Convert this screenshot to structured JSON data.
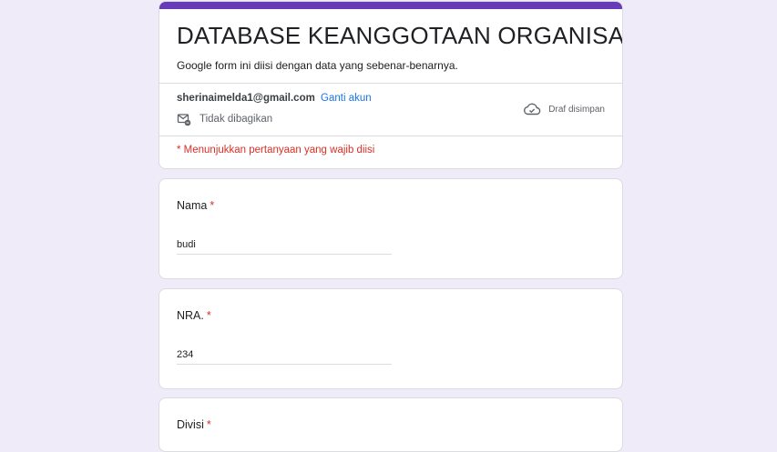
{
  "form": {
    "title": "DATABASE KEANGGOTAAN ORGANISASI",
    "description": "Google form ini diisi dengan data yang sebenar-benarnya.",
    "account_email": "sherinaimelda1@gmail.com",
    "switch_account": "Ganti akun",
    "not_shared": "Tidak dibagikan",
    "draft_saved": "Draf disimpan",
    "required_note": "* Menunjukkan pertanyaan yang wajib diisi",
    "accent_color": "#673ab7",
    "background_color": "#efebf8"
  },
  "questions": [
    {
      "label": "Nama",
      "required_mark": "*",
      "value": "budi"
    },
    {
      "label": "NRA.",
      "required_mark": "*",
      "value": "234"
    },
    {
      "label": "Divisi",
      "required_mark": "*"
    }
  ],
  "icons": {
    "share": "mail-share-icon",
    "draft": "cloud-check-icon"
  }
}
